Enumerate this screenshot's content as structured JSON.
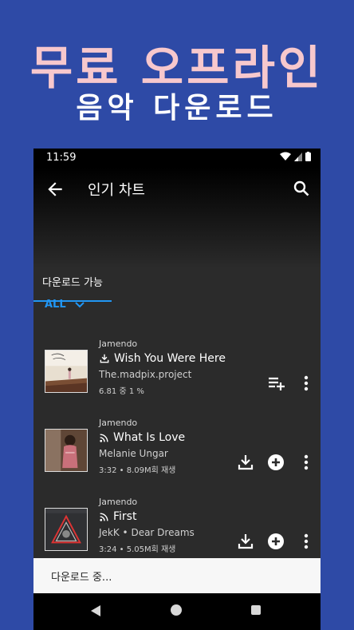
{
  "promo": {
    "headline": "무료 오프라인",
    "subheadline": "음악 다운로드"
  },
  "status_bar": {
    "time": "11:59"
  },
  "app_bar": {
    "title": "인기 차트"
  },
  "tabs": [
    {
      "label": "다운로드 가능",
      "selected": true
    }
  ],
  "filter": {
    "label": "ALL"
  },
  "tracks": [
    {
      "source": "Jamendo",
      "title": "Wish You Were Here",
      "artist": "The.madpix.project",
      "meta": "6.81 중 1 %",
      "state": "downloading",
      "progress_percent": 1
    },
    {
      "source": "Jamendo",
      "title": "What Is Love",
      "artist": "Melanie Ungar",
      "meta": "3:32 • 8.09M회 재생",
      "state": "stream"
    },
    {
      "source": "Jamendo",
      "title": "First",
      "artist": "JekK • Dear Dreams",
      "meta": "3:24 • 5.05M회 재생",
      "state": "stream"
    }
  ],
  "snackbar": {
    "text": "다운로드 중..."
  },
  "colors": {
    "accent": "#2196f3",
    "promo_bg": "#2e4aa6",
    "promo_text": "#f7c8cd"
  }
}
